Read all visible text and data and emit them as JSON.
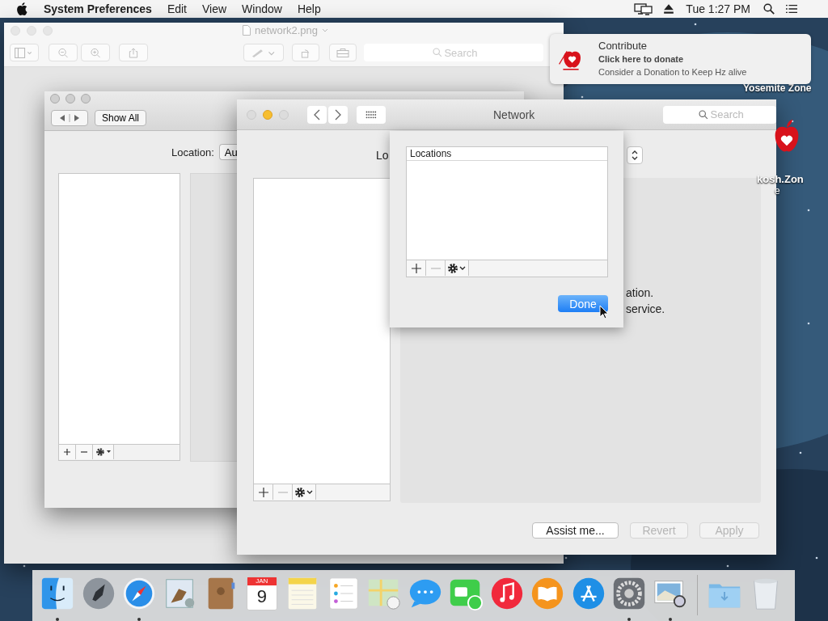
{
  "menu_bar": {
    "app_name": "System Preferences",
    "menus": [
      "Edit",
      "View",
      "Window",
      "Help"
    ],
    "clock": "Tue 1:27 PM"
  },
  "preview_window": {
    "title": "network2.png",
    "search": {
      "placeholder": "Search"
    }
  },
  "back_window": {
    "show_all": "Show All",
    "location_label": "Location:",
    "location_value": "Au"
  },
  "network_window": {
    "title": "Network",
    "search": {
      "placeholder": "Search"
    },
    "location_label": "Lo",
    "panel_lines": [
      "ation.",
      "service."
    ],
    "buttons": [
      {
        "label": "Assist me...",
        "disabled": false
      },
      {
        "label": "Revert",
        "disabled": true
      },
      {
        "label": "Apply",
        "disabled": true
      }
    ]
  },
  "locations_sheet": {
    "column": "Locations",
    "done": "Done"
  },
  "notification": {
    "title": "Contribute",
    "subtitle": "Click here to donate",
    "body": "Consider a Donation to Keep Hz alive"
  },
  "desktop_labels": [
    {
      "lines": [
        "Yosemite Zone"
      ]
    },
    {
      "lines": [
        "kosh.Zon",
        "e"
      ]
    }
  ],
  "dock": {
    "items": [
      {
        "kind": "finder",
        "running": true
      },
      {
        "kind": "launchpad",
        "running": false
      },
      {
        "kind": "safari",
        "running": true
      },
      {
        "kind": "mail",
        "running": false
      },
      {
        "kind": "contacts",
        "running": false
      },
      {
        "kind": "calendar",
        "month": "JAN",
        "day": "9",
        "running": false
      },
      {
        "kind": "notes",
        "running": false
      },
      {
        "kind": "reminders",
        "running": false
      },
      {
        "kind": "maps",
        "running": false
      },
      {
        "kind": "messages",
        "running": false
      },
      {
        "kind": "facetime",
        "running": false
      },
      {
        "kind": "music",
        "running": false
      },
      {
        "kind": "books",
        "running": false
      },
      {
        "kind": "store",
        "running": false
      },
      {
        "kind": "settings",
        "running": true
      },
      {
        "kind": "preview",
        "running": true
      },
      {
        "kind": "folder",
        "running": false
      },
      {
        "kind": "trash",
        "running": false
      }
    ]
  }
}
